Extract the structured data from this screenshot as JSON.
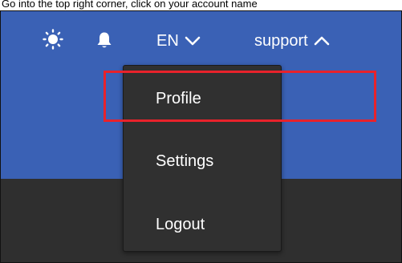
{
  "instruction": "Go into the top right corner, click on your account name",
  "header": {
    "theme_icon": "sun-icon",
    "notifications_icon": "bell-icon",
    "language": "EN",
    "language_chevron": "chevron-down-icon",
    "account_name": "support",
    "account_chevron": "chevron-up-icon"
  },
  "account_menu": {
    "items": [
      {
        "label": "Profile"
      },
      {
        "label": "Settings"
      },
      {
        "label": "Logout"
      }
    ]
  },
  "colors": {
    "header_bg": "#3a61b5",
    "page_bg": "#2f2f2f",
    "menu_bg": "#303030",
    "highlight": "#e8222b"
  }
}
